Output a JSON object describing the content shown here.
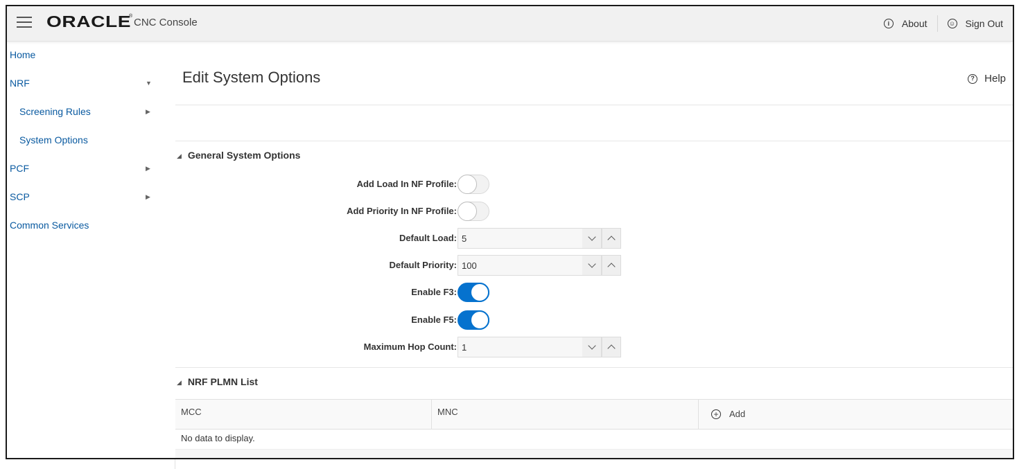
{
  "header": {
    "brand": "ORACLE",
    "brand_mark": "®",
    "product": "CNC Console",
    "about_label": "About",
    "signout_label": "Sign Out"
  },
  "sidebar": {
    "items": [
      {
        "label": "Home",
        "level": 0,
        "arrow": ""
      },
      {
        "label": "NRF",
        "level": 0,
        "arrow": "▼"
      },
      {
        "label": "Screening Rules",
        "level": 1,
        "arrow": "▶"
      },
      {
        "label": "System Options",
        "level": 1,
        "arrow": ""
      },
      {
        "label": "PCF",
        "level": 0,
        "arrow": "▶"
      },
      {
        "label": "SCP",
        "level": 0,
        "arrow": "▶"
      },
      {
        "label": "Common Services",
        "level": 0,
        "arrow": ""
      }
    ]
  },
  "page": {
    "title": "Edit System Options",
    "help_label": "Help"
  },
  "general": {
    "title": "General System Options",
    "fields": {
      "add_load": {
        "label": "Add Load In NF Profile:",
        "on": false
      },
      "add_priority": {
        "label": "Add Priority In NF Profile:",
        "on": false
      },
      "default_load": {
        "label": "Default Load:",
        "value": "5"
      },
      "default_priority": {
        "label": "Default Priority:",
        "value": "100"
      },
      "enable_f3": {
        "label": "Enable F3:",
        "on": true
      },
      "enable_f5": {
        "label": "Enable F5:",
        "on": true
      },
      "max_hop": {
        "label": "Maximum Hop Count:",
        "value": "1"
      }
    }
  },
  "plmn": {
    "title": "NRF PLMN List",
    "columns": [
      "MCC",
      "MNC"
    ],
    "add_label": "Add",
    "empty_text": "No data to display."
  },
  "colors": {
    "accent": "#0572ce",
    "link": "#0a5aa0",
    "header_bg": "#f1f1f1"
  },
  "icons": [
    "hamburger-icon",
    "info-icon",
    "user-circle-icon",
    "help-circle-icon",
    "plus-circle-icon",
    "chevron-down-icon",
    "chevron-up-icon"
  ]
}
